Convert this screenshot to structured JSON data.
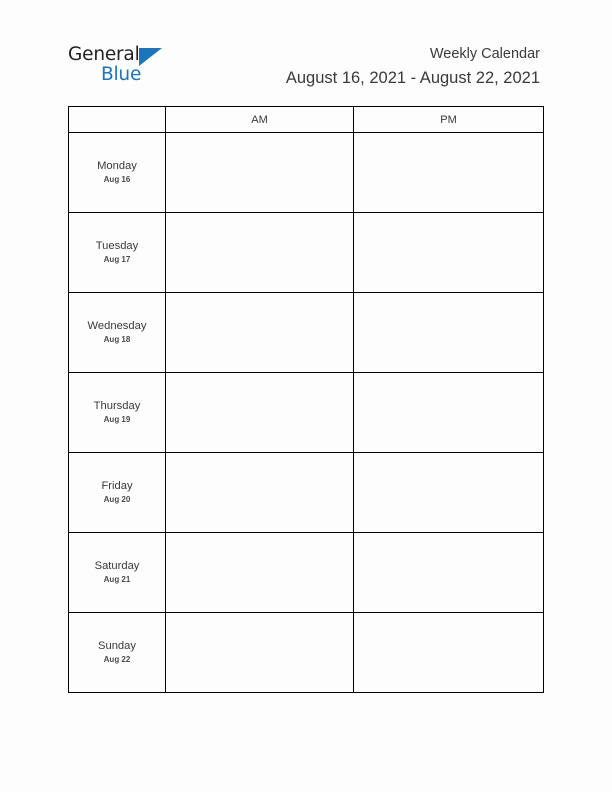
{
  "brand": {
    "name_line1": "General",
    "name_line2": "Blue",
    "accent_color": "#1b75bb",
    "text_color": "#231f20"
  },
  "header": {
    "title": "Weekly Calendar",
    "date_range": "August 16, 2021 - August 22, 2021"
  },
  "table": {
    "columns": [
      "",
      "AM",
      "PM"
    ],
    "rows": [
      {
        "day": "Monday",
        "date": "Aug 16",
        "am": "",
        "pm": ""
      },
      {
        "day": "Tuesday",
        "date": "Aug 17",
        "am": "",
        "pm": ""
      },
      {
        "day": "Wednesday",
        "date": "Aug 18",
        "am": "",
        "pm": ""
      },
      {
        "day": "Thursday",
        "date": "Aug 19",
        "am": "",
        "pm": ""
      },
      {
        "day": "Friday",
        "date": "Aug 20",
        "am": "",
        "pm": ""
      },
      {
        "day": "Saturday",
        "date": "Aug 21",
        "am": "",
        "pm": ""
      },
      {
        "day": "Sunday",
        "date": "Aug 22",
        "am": "",
        "pm": ""
      }
    ]
  }
}
